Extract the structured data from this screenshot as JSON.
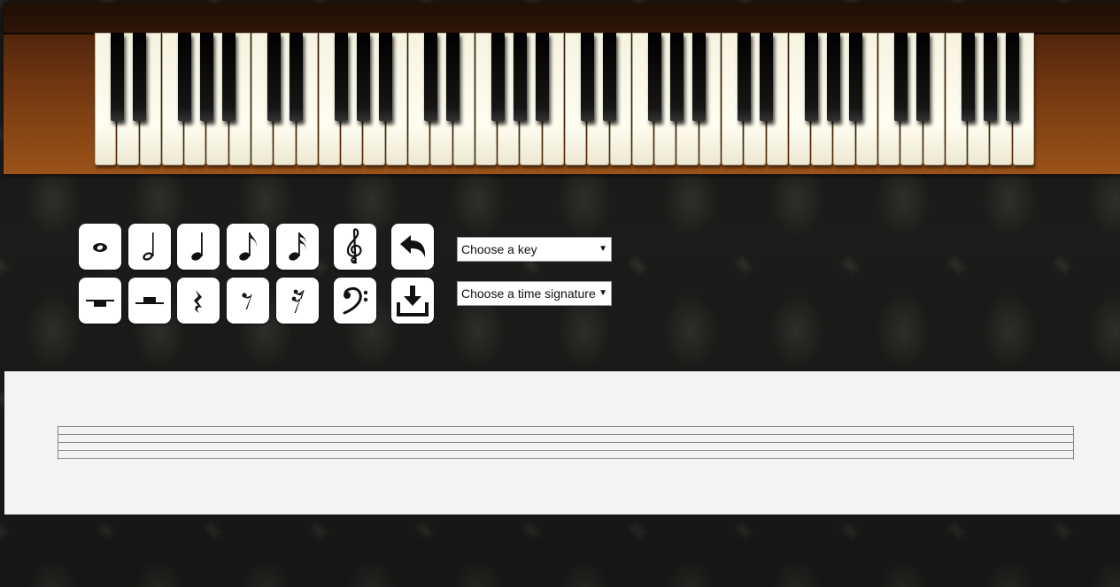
{
  "piano": {
    "white_key_count": 42,
    "black_key_pattern": "C#,D#,F#,G#,A#"
  },
  "toolbar": {
    "notes": [
      "whole-note",
      "half-note",
      "quarter-note",
      "eighth-note",
      "sixteenth-note"
    ],
    "rests": [
      "whole-rest",
      "half-rest",
      "quarter-rest",
      "eighth-rest",
      "sixteenth-rest"
    ],
    "clefs": [
      "treble-clef",
      "bass-clef"
    ],
    "actions": [
      "undo",
      "download"
    ]
  },
  "key_select": {
    "label": "Choose a key"
  },
  "time_select": {
    "label": "Choose a time signature"
  },
  "staff": {
    "line_count": 5
  }
}
